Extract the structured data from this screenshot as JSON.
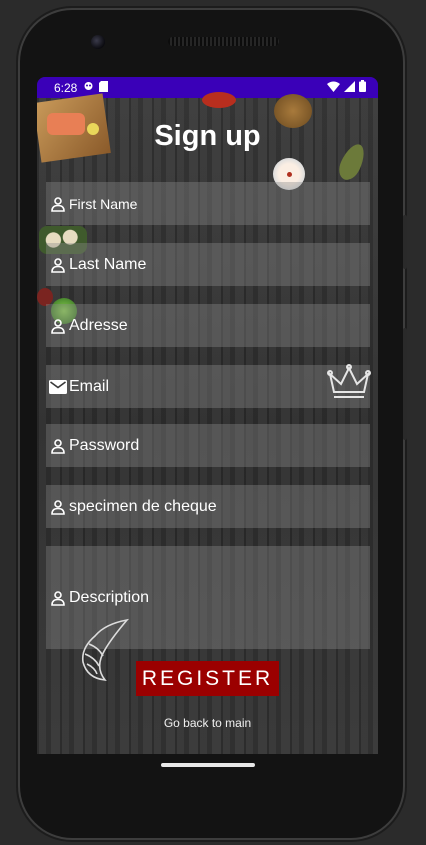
{
  "status_bar": {
    "time": "6:28",
    "left_icons": [
      "notification-icon",
      "sim-icon"
    ],
    "right_icons": [
      "wifi-icon",
      "signal-icon",
      "battery-icon"
    ],
    "color": "#3a00b8"
  },
  "page": {
    "title": "Sign up"
  },
  "form": {
    "fields": [
      {
        "label": "First Name",
        "icon": "person-icon"
      },
      {
        "label": "Last Name",
        "icon": "person-icon"
      },
      {
        "label": "Adresse",
        "icon": "person-icon"
      },
      {
        "label": "Email",
        "icon": "mail-icon"
      },
      {
        "label": "Password",
        "icon": "person-icon"
      },
      {
        "label": "specimen de cheque",
        "icon": "person-icon"
      },
      {
        "label": "Description",
        "icon": "person-icon"
      }
    ],
    "register_label": "REGISTER",
    "register_color": "#9b0000",
    "back_label": "Go back to main"
  }
}
